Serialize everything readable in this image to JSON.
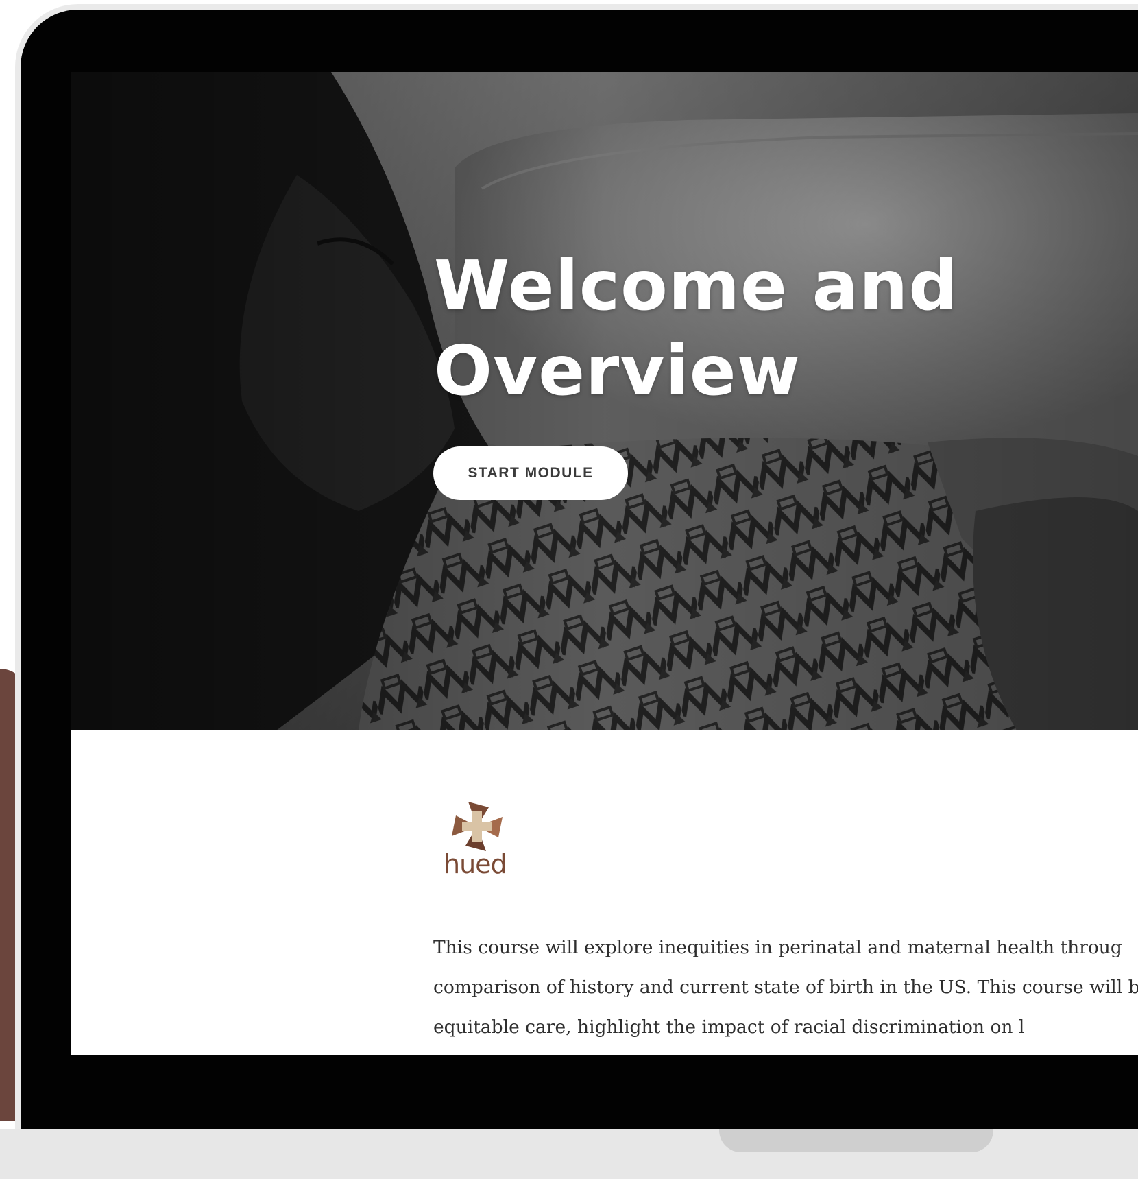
{
  "hero": {
    "title": "Welcome and Overview",
    "button_label": "START MODULE"
  },
  "logo": {
    "text": "hued",
    "icon": "pinwheel-cross-logo"
  },
  "course": {
    "description": "This course will explore inequities in perinatal and maternal health throug comparison of history and current state of birth in the US. This course will barriers to equitable care, highlight the impact of racial discrimination on l"
  },
  "colors": {
    "accent_brown": "#6b453d",
    "logo_brown": "#7a4a35",
    "logo_tan": "#d9c3a5",
    "bezel": "#020202"
  }
}
